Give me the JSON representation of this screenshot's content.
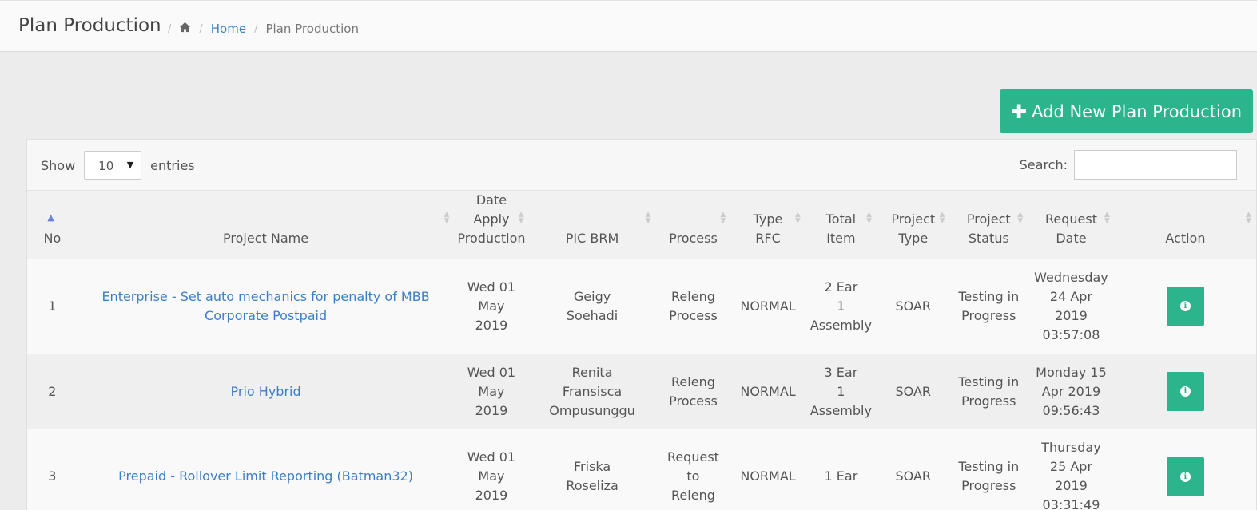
{
  "header": {
    "title": "Plan Production",
    "breadcrumb": {
      "home_icon": "home-icon",
      "home_label": "Home",
      "current": "Plan Production"
    }
  },
  "add_button": {
    "icon": "plus-icon",
    "label": "Add New Plan Production"
  },
  "controls": {
    "show_label": "Show",
    "page_size": "10",
    "entries_label": "entries",
    "search_label": "Search:",
    "search_value": ""
  },
  "colors": {
    "accent": "#2cb48c",
    "link": "#3d7fc7"
  },
  "table": {
    "columns": [
      {
        "line1": "",
        "line2": "No"
      },
      {
        "line1": "",
        "line2": "Project Name"
      },
      {
        "line1": "Date Apply",
        "line2": "Production"
      },
      {
        "line1": "",
        "line2": "PIC BRM"
      },
      {
        "line1": "",
        "line2": "Process"
      },
      {
        "line1": "Type",
        "line2": "RFC"
      },
      {
        "line1": "Total",
        "line2": "Item"
      },
      {
        "line1": "Project",
        "line2": "Type"
      },
      {
        "line1": "Project",
        "line2": "Status"
      },
      {
        "line1": "Request",
        "line2": "Date"
      },
      {
        "line1": "",
        "line2": "Action"
      }
    ],
    "rows": [
      {
        "no": "1",
        "project_name": [
          "Enterprise - Set auto mechanics for penalty of MBB",
          "Corporate Postpaid"
        ],
        "date_apply": [
          "Wed 01 May",
          "2019"
        ],
        "pic_brm": [
          "Geigy",
          "Soehadi"
        ],
        "process": [
          "Releng",
          "Process"
        ],
        "type_rfc": "NORMAL",
        "total_item": [
          "2 Ear",
          "1",
          "Assembly"
        ],
        "project_type": "SOAR",
        "project_status": [
          "Testing in",
          "Progress"
        ],
        "request_date": [
          "Wednesday",
          "24 Apr",
          "2019",
          "03:57:08"
        ],
        "action_icon": "info-icon"
      },
      {
        "no": "2",
        "project_name": [
          "Prio Hybrid"
        ],
        "date_apply": [
          "Wed 01 May",
          "2019"
        ],
        "pic_brm": [
          "Renita",
          "Fransisca",
          "Ompusunggu"
        ],
        "process": [
          "Releng",
          "Process"
        ],
        "type_rfc": "NORMAL",
        "total_item": [
          "3 Ear",
          "1",
          "Assembly"
        ],
        "project_type": "SOAR",
        "project_status": [
          "Testing in",
          "Progress"
        ],
        "request_date": [
          "Monday 15",
          "Apr 2019",
          "09:56:43"
        ],
        "action_icon": "info-icon"
      },
      {
        "no": "3",
        "project_name": [
          "Prepaid - Rollover Limit Reporting (Batman32)"
        ],
        "date_apply": [
          "Wed 01 May",
          "2019"
        ],
        "pic_brm": [
          "Friska",
          "Roseliza"
        ],
        "process": [
          "Request to",
          "Releng"
        ],
        "type_rfc": "NORMAL",
        "total_item": [
          "1 Ear"
        ],
        "project_type": "SOAR",
        "project_status": [
          "Testing in",
          "Progress"
        ],
        "request_date": [
          "Thursday",
          "25 Apr",
          "2019",
          "03:31:49"
        ],
        "action_icon": "info-icon"
      }
    ]
  }
}
